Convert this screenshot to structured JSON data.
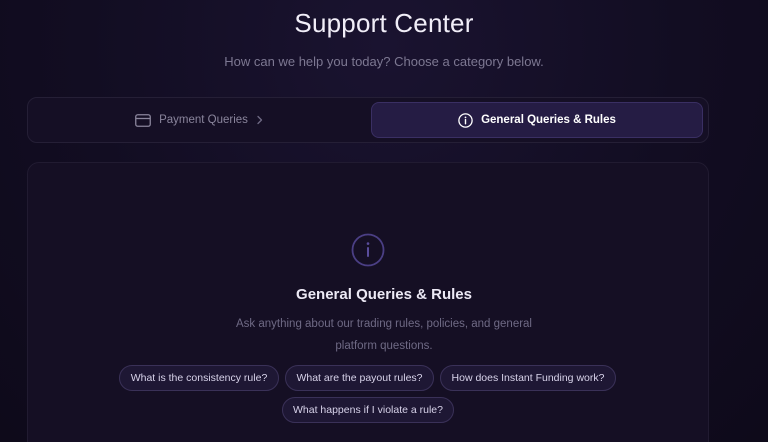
{
  "header": {
    "title": "Support Center",
    "subtitle": "How can we help you today? Choose a category below."
  },
  "tabs": [
    {
      "label": "Payment Queries",
      "icon": "credit-card-icon",
      "active": false
    },
    {
      "label": "General Queries & Rules",
      "icon": "info-icon",
      "active": true
    }
  ],
  "panel": {
    "icon": "info-icon",
    "title": "General Queries & Rules",
    "description": "Ask anything about our trading rules, policies, and general platform questions.",
    "suggestions": [
      "What is the consistency rule?",
      "What are the payout rules?",
      "How does Instant Funding work?",
      "What happens if I violate a rule?"
    ]
  },
  "colors": {
    "background": "#110c20",
    "active_tab": "#251c44",
    "accent": "#7b6bc4"
  }
}
